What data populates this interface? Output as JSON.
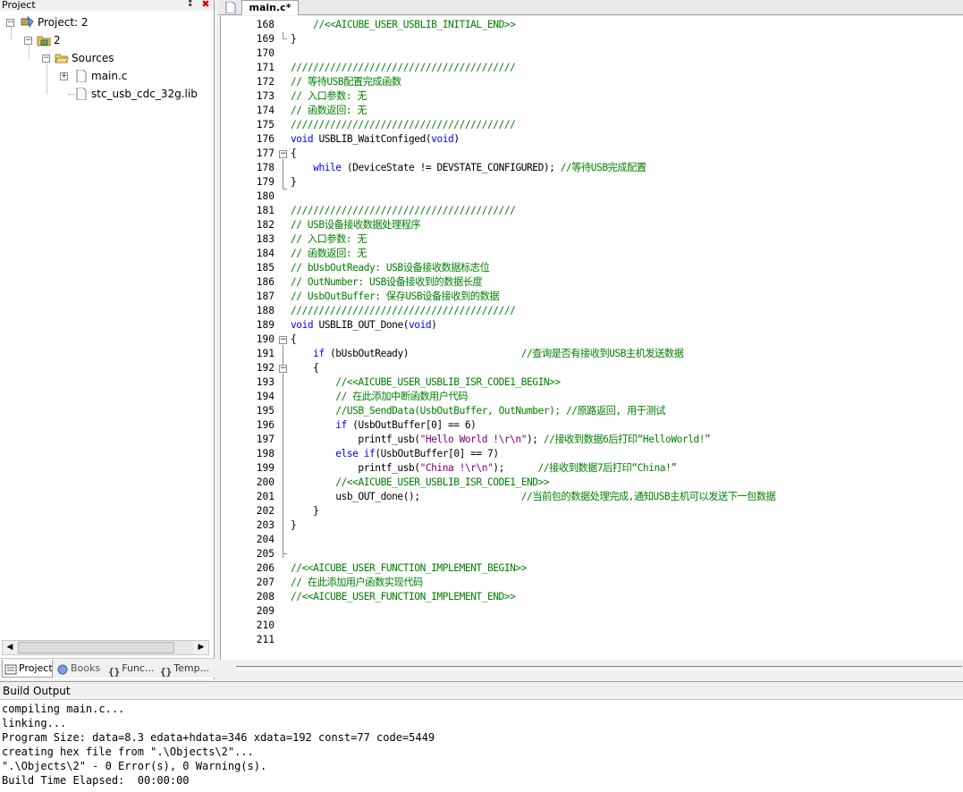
{
  "project_pane": {
    "title": "Project",
    "tree": {
      "project_label": "Project: 2",
      "target_label": "2",
      "group_label": "Sources",
      "files": [
        "main.c",
        "stc_usb_cdc_32g.lib"
      ]
    },
    "tabs": [
      "Project",
      "Books",
      "Func...",
      "Temp..."
    ]
  },
  "editor": {
    "tab_label": "main.c*",
    "line_numbers": [
      "168",
      "169",
      "170",
      "171",
      "172",
      "173",
      "174",
      "175",
      "176",
      "177",
      "178",
      "179",
      "180",
      "181",
      "182",
      "183",
      "184",
      "185",
      "186",
      "187",
      "188",
      "189",
      "190",
      "191",
      "192",
      "193",
      "194",
      "195",
      "196",
      "197",
      "198",
      "199",
      "200",
      "201",
      "202",
      "203",
      "204",
      "205",
      "206",
      "207",
      "208",
      "209",
      "210",
      "211"
    ],
    "lines": [
      "    //<<AICUBE_USER_USBLIB_INITIAL_END>>",
      "}",
      "",
      "////////////////////////////////////////",
      "// 等待USB配置完成函数",
      "// 入口参数: 无",
      "// 函数返回: 无",
      "////////////////////////////////////////",
      "void USBLIB_WaitConfiged(void)",
      "{",
      "    while (DeviceState != DEVSTATE_CONFIGURED); //等待USB完成配置",
      "}",
      "",
      "////////////////////////////////////////",
      "// USB设备接收数据处理程序",
      "// 入口参数: 无",
      "// 函数返回: 无",
      "// bUsbOutReady: USB设备接收数据标志位",
      "// OutNumber: USB设备接收到的数据长度",
      "// UsbOutBuffer: 保存USB设备接收到的数据",
      "////////////////////////////////////////",
      "void USBLIB_OUT_Done(void)",
      "{",
      "    if (bUsbOutReady)                    //查询是否有接收到USB主机发送数据",
      "    {",
      "        //<<AICUBE_USER_USBLIB_ISR_CODE1_BEGIN>>",
      "        // 在此添加中断函数用户代码",
      "        //USB_SendData(UsbOutBuffer, OutNumber); //原路返回, 用于测试",
      "        if (UsbOutBuffer[0] == 6)",
      "            printf_usb(\"Hello World !\\r\\n\"); //接收到数据6后打印“HelloWorld!”",
      "        else if(UsbOutBuffer[0] == 7)",
      "            printf_usb(\"China !\\r\\n\");      //接收到数据7后打印“China!”",
      "        //<<AICUBE_USER_USBLIB_ISR_CODE1_END>>",
      "        usb_OUT_done();                  //当前包的数据处理完成,通知USB主机可以发送下一包数据",
      "    }",
      "}",
      "",
      "",
      "//<<AICUBE_USER_FUNCTION_IMPLEMENT_BEGIN>>",
      "// 在此添加用户函数实现代码",
      "//<<AICUBE_USER_FUNCTION_IMPLEMENT_END>>",
      "",
      "",
      ""
    ]
  },
  "build_output": {
    "title": "Build Output",
    "lines": [
      "compiling main.c...",
      "linking...",
      "Program Size: data=8.3 edata+hdata=346 xdata=192 const=77 code=5449",
      "creating hex file from \".\\Objects\\2\"...",
      "\".\\Objects\\2\" - 0 Error(s), 0 Warning(s).",
      "Build Time Elapsed:  00:00:00"
    ]
  },
  "colors": {
    "comment": "#008000",
    "keyword": "#0000ff",
    "string": "#800080"
  }
}
